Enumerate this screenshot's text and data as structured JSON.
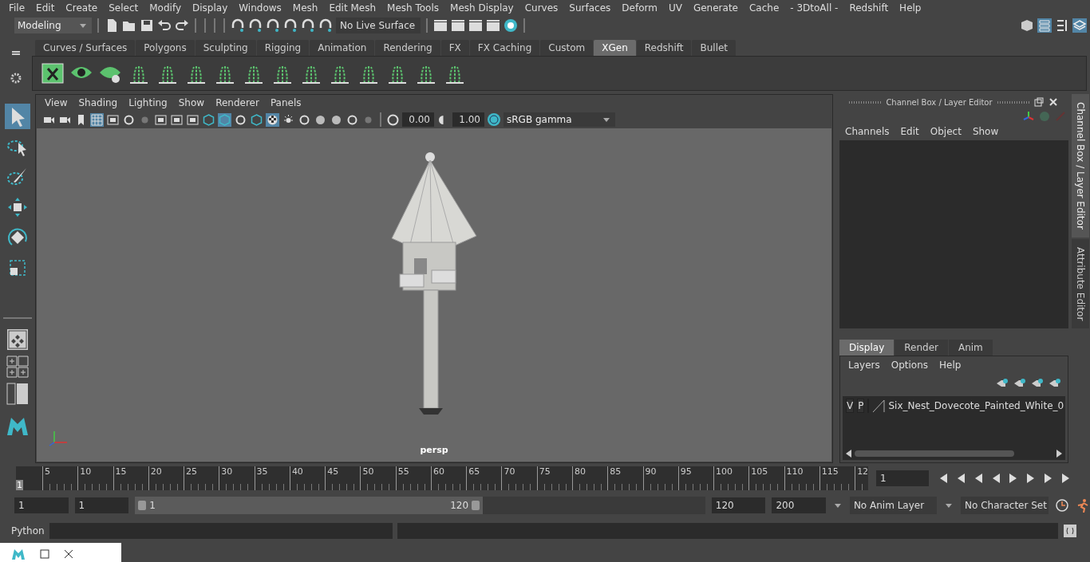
{
  "menu_bar": [
    "File",
    "Edit",
    "Create",
    "Select",
    "Modify",
    "Display",
    "Windows",
    "Mesh",
    "Edit Mesh",
    "Mesh Tools",
    "Mesh Display",
    "Curves",
    "Surfaces",
    "Deform",
    "UV",
    "Generate",
    "Cache",
    "- 3DtoAll -",
    "Redshift",
    "Help"
  ],
  "toolbar": {
    "mode": "Modeling",
    "live_surface": "No Live Surface"
  },
  "shelf": {
    "tabs": [
      {
        "label": "Curves / Surfaces",
        "selected": false
      },
      {
        "label": "Polygons",
        "selected": false
      },
      {
        "label": "Sculpting",
        "selected": false
      },
      {
        "label": "Rigging",
        "selected": false
      },
      {
        "label": "Animation",
        "selected": false
      },
      {
        "label": "Rendering",
        "selected": false
      },
      {
        "label": "FX",
        "selected": false
      },
      {
        "label": "FX Caching",
        "selected": false
      },
      {
        "label": "Custom",
        "selected": false
      },
      {
        "label": "XGen",
        "selected": true
      },
      {
        "label": "Redshift",
        "selected": false
      },
      {
        "label": "Bullet",
        "selected": false
      }
    ]
  },
  "tools": [
    {
      "kind": "select",
      "selected": true
    },
    {
      "kind": "lasso",
      "selected": false
    },
    {
      "kind": "paint",
      "selected": false
    },
    {
      "kind": "move",
      "selected": false
    },
    {
      "kind": "rotate",
      "selected": false
    },
    {
      "kind": "scale",
      "selected": false
    }
  ],
  "viewport": {
    "menu": [
      "View",
      "Shading",
      "Lighting",
      "Show",
      "Renderer",
      "Panels"
    ],
    "toolbar_icons": [
      {
        "kind": "camera",
        "on": false
      },
      {
        "kind": "camera",
        "on": false
      },
      {
        "kind": "bookmark",
        "on": false
      },
      {
        "kind": "grid",
        "on": true
      },
      {
        "kind": "film",
        "on": false
      },
      {
        "kind": "circle",
        "on": false
      },
      {
        "kind": "dot",
        "on": false
      },
      {
        "kind": "film",
        "on": false
      },
      {
        "kind": "film",
        "on": false
      },
      {
        "kind": "film",
        "on": false
      },
      {
        "kind": "cube",
        "on": false
      },
      {
        "kind": "cube",
        "on": true
      },
      {
        "kind": "circle",
        "on": false
      },
      {
        "kind": "cube",
        "on": false
      },
      {
        "kind": "checker",
        "on": true
      },
      {
        "kind": "light",
        "on": false
      },
      {
        "kind": "circle",
        "on": false
      },
      {
        "kind": "sphere",
        "on": false
      },
      {
        "kind": "sphere",
        "on": false
      },
      {
        "kind": "circle",
        "on": false
      },
      {
        "kind": "dot",
        "on": false
      }
    ],
    "exposure": "0.00",
    "gamma": "1.00",
    "color_space": "sRGB gamma",
    "camera": "persp"
  },
  "channel_box": {
    "title": "Channel Box / Layer Editor",
    "menu": [
      "Channels",
      "Edit",
      "Object",
      "Show"
    ]
  },
  "layer_editor": {
    "tabs": [
      {
        "label": "Display",
        "selected": true
      },
      {
        "label": "Render",
        "selected": false
      },
      {
        "label": "Anim",
        "selected": false
      }
    ],
    "menu": [
      "Layers",
      "Options",
      "Help"
    ],
    "layers": [
      {
        "visibility": "V",
        "playback": "P",
        "name": "Six_Nest_Dovecote_Painted_White_0"
      }
    ]
  },
  "side_tabs": [
    {
      "label": "Channel Box / Layer Editor",
      "selected": true
    },
    {
      "label": "Attribute Editor",
      "selected": false
    }
  ],
  "timeline": {
    "start": "1",
    "labels": [
      "5",
      "10",
      "15",
      "20",
      "25",
      "30",
      "35",
      "40",
      "45",
      "50",
      "55",
      "60",
      "65",
      "70",
      "75",
      "80",
      "85",
      "90",
      "95",
      "100",
      "105",
      "110",
      "115",
      "12"
    ],
    "current_frame": "1"
  },
  "range": {
    "start": "1",
    "playback_start": "1",
    "slider_start": "1",
    "slider_end": "120",
    "level": 0.61,
    "playback_end": "120",
    "end": "200",
    "anim_layer": "No Anim Layer",
    "character_set": "No Character Set"
  },
  "command_line": {
    "language": "Python"
  }
}
